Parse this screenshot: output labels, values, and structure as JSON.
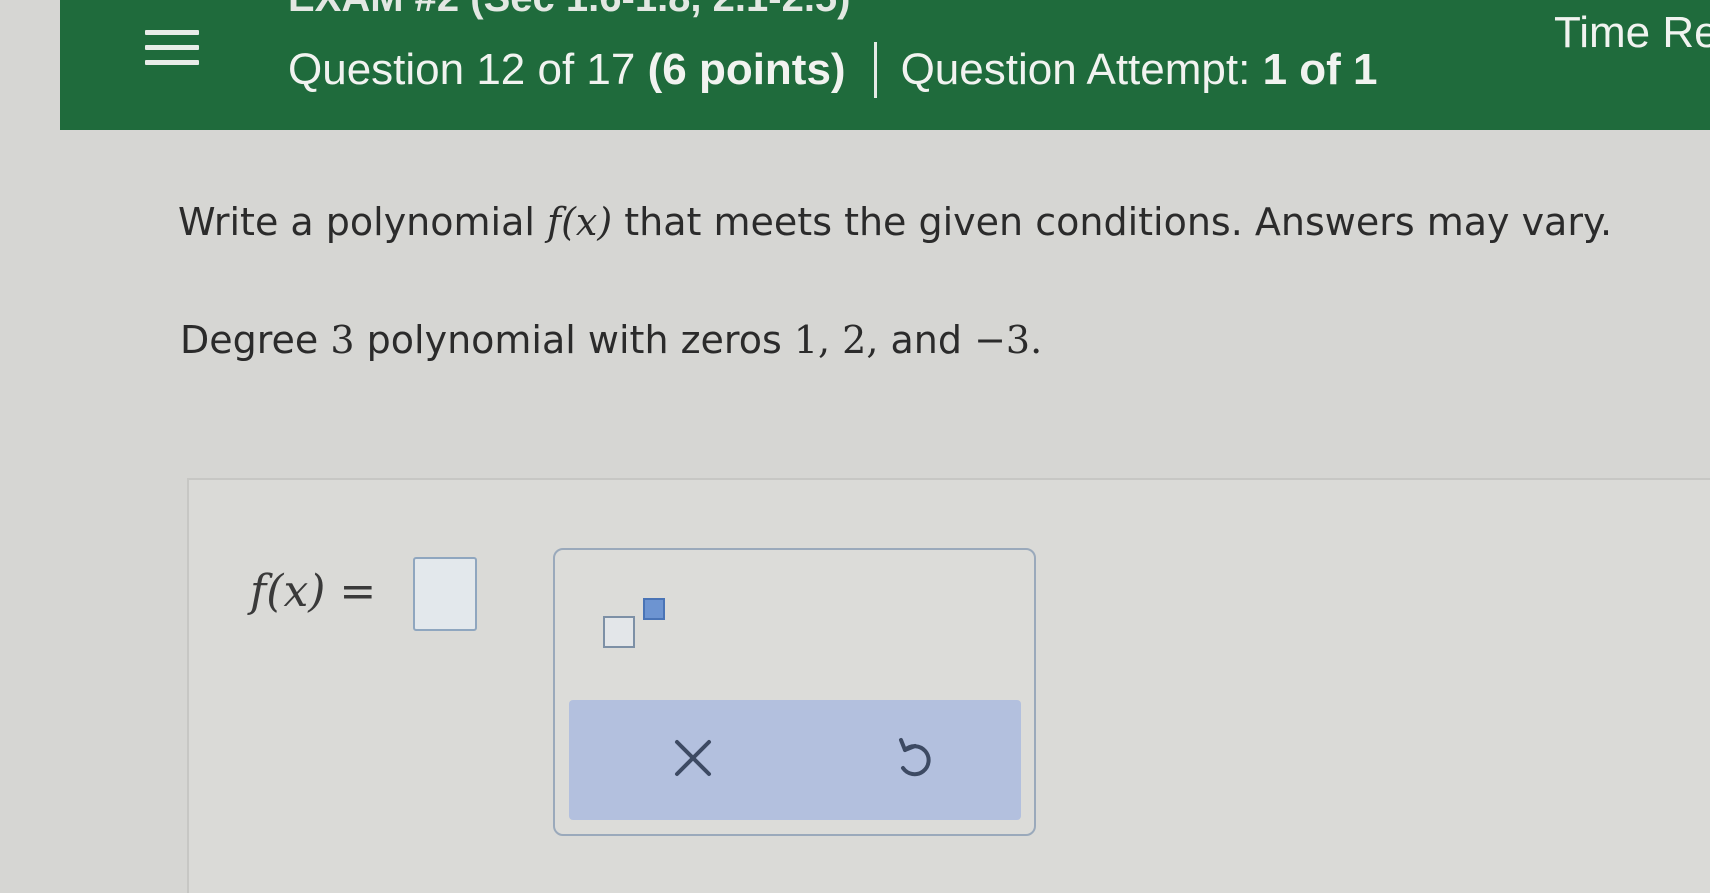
{
  "header": {
    "exam_title": "EXAM #2 (Sec 1.6-1.8, 2.1-2.5)",
    "question_prefix": "Question 12 of 17",
    "points": "(6 points)",
    "attempt_prefix": "Question Attempt:",
    "attempt_value": "1 of 1",
    "time_label": "Time Re"
  },
  "question": {
    "prompt_before": "Write a polynomial ",
    "prompt_func": "f",
    "prompt_var": "(x)",
    "prompt_after": " that meets the given conditions. Answers may vary.",
    "condition_before": "Degree ",
    "degree": "3",
    "condition_mid": " polynomial with zeros ",
    "zeros": "1,  2,",
    "condition_and": "  and ",
    "last_zero": "−3."
  },
  "answer": {
    "label": "f(x) =",
    "input_value": ""
  },
  "palette": {
    "exponent_icon": "exponent-template-icon",
    "clear_icon": "x-icon",
    "undo_icon": "undo-icon"
  },
  "colors": {
    "header_green": "#1f6b3c",
    "palette_action_bar": "#b3c0de",
    "input_border": "#8fa6bf"
  }
}
